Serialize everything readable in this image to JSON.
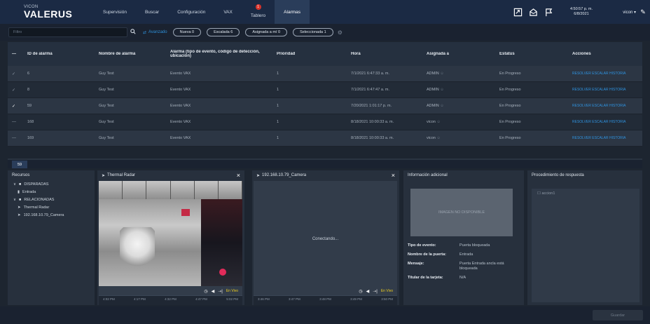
{
  "brand": {
    "small": "VICON",
    "name": "VALERUS"
  },
  "nav": {
    "tabs": [
      {
        "label": "Supervisión"
      },
      {
        "label": "Buscar"
      },
      {
        "label": "Configuración"
      },
      {
        "label": "VAX"
      },
      {
        "label": "Tablero",
        "badge": "1"
      },
      {
        "label": "Alarmas"
      }
    ],
    "active": "Alarmas"
  },
  "topbar": {
    "time": "4:50:57 p. m.",
    "date": "6/8/2021",
    "user": "vicon"
  },
  "filterbar": {
    "filter_placeholder": "Filtro",
    "advanced_label": "Avanzado",
    "chips": [
      {
        "label": "Nueva  0"
      },
      {
        "label": "Escalada  6"
      },
      {
        "label": "Asignada a mí  0"
      },
      {
        "label": "Seleccionada  1"
      }
    ]
  },
  "table": {
    "headers": [
      "ID de alarma",
      "Nombre de alarma",
      "Alarma (tipo de evento, código de detección, ubicación)",
      "Prioridad",
      "Hora",
      "Asignada a",
      "Estatus",
      "Acciones"
    ],
    "rows": [
      {
        "id": "6",
        "name": "Guy Test",
        "alarm": "Evento VAX",
        "priority": "1",
        "time": "7/1/2021 6:47:33 a. m.",
        "assigned": "ADMIN",
        "status": "En Progreso",
        "action": "RESOLVER ESCALAR HISTORIA",
        "checked": "✓"
      },
      {
        "id": "8",
        "name": "Guy Test",
        "alarm": "Evento VAX",
        "priority": "1",
        "time": "7/1/2021 6:47:47 a. m.",
        "assigned": "ADMIN",
        "status": "En Progreso",
        "action": "RESOLVER ESCALAR HISTORIA",
        "checked": "✓"
      },
      {
        "id": "59",
        "name": "Guy Test",
        "alarm": "Evento VAX",
        "priority": "1",
        "time": "7/20/2021 1:01:17 p. m.",
        "assigned": "ADMIN",
        "status": "En Progreso",
        "action": "RESOLVER ESCALAR HISTORIA",
        "checked": "✓"
      },
      {
        "id": "168",
        "name": "Guy Test",
        "alarm": "Evento VAX",
        "priority": "1",
        "time": "8/18/2021 10:00:33 a. m.",
        "assigned": "vicon",
        "status": "En Progreso",
        "action": "RESOLVER ESCALAR HISTORIA",
        "checked": "—"
      },
      {
        "id": "169",
        "name": "Guy Test",
        "alarm": "Evento VAX",
        "priority": "1",
        "time": "8/18/2021 10:00:33 a. m.",
        "assigned": "vicon",
        "status": "En Progreso",
        "action": "RESOLVER ESCALAR HISTORIA",
        "checked": "—"
      }
    ]
  },
  "selected_tab": "59",
  "resources": {
    "title": "Recursos",
    "items": [
      {
        "label": "DISPARADAS"
      },
      {
        "label": "Entrada"
      },
      {
        "label": "RELACIONADAS"
      },
      {
        "label": "Thermal Radar"
      },
      {
        "label": "192.168.10.79_Camera"
      }
    ]
  },
  "thermal_panel": {
    "title": "Thermal Radar",
    "live": "En Vivo",
    "times": [
      "4:02 PM",
      "4:17 PM",
      "4:32 PM",
      "4:47 PM",
      "5:02 PM"
    ]
  },
  "camera_panel": {
    "title": "192.168.10.79_Camera",
    "status": "Conectando...",
    "live": "En Vivo",
    "times": [
      "3:46 PM",
      "3:47 PM",
      "3:48 PM",
      "3:49 PM",
      "3:50 PM"
    ]
  },
  "info_panel": {
    "title": "Información adicional",
    "image_placeholder": "IMAGEN NO DISPONIBLE",
    "fields": [
      {
        "label": "Tipo de evento:",
        "value": "Puerta bloqueada"
      },
      {
        "label": "Nombre de la puerta:",
        "value": "Entrada"
      },
      {
        "label": "Mensaje:",
        "value": "Puerta Entrada ancla está bloqueada"
      },
      {
        "label": "Titular de la tarjeta:",
        "value": "N/A"
      }
    ]
  },
  "procedure_panel": {
    "title": "Procedimiento de respuesta",
    "item": "accion1"
  },
  "footer": {
    "button": "Guardar"
  },
  "colors": {
    "accent": "#2f93e0",
    "nav": "#1b2a44",
    "badge": "#d9342b"
  }
}
